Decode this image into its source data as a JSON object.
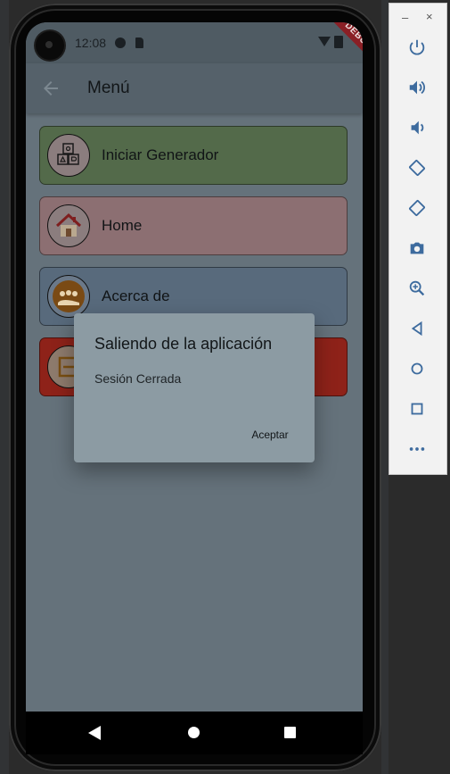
{
  "status_bar": {
    "time": "12:08",
    "debug_banner": "DEBUG"
  },
  "app_bar": {
    "title": "Menú",
    "back_icon": "arrow-back-icon"
  },
  "menu_items": [
    {
      "label": "Iniciar Generador",
      "icon": "toy-blocks-icon",
      "color": "#536a4a"
    },
    {
      "label": "Home",
      "icon": "house-icon",
      "color": "#8c6f72"
    },
    {
      "label": "Acerca de",
      "icon": "team-icon",
      "color": "#586a7c"
    },
    {
      "label": "",
      "icon": "exit-icon",
      "color": "#8e2219"
    }
  ],
  "dialog": {
    "title": "Saliendo de la aplicación",
    "message": "Sesión Cerrada",
    "accept_label": "Aceptar"
  },
  "nav_bar": {
    "back_icon": "nav-back-icon",
    "home_icon": "nav-home-icon",
    "recents_icon": "nav-recents-icon"
  },
  "emulator_panel": {
    "minimize_glyph": "–",
    "close_glyph": "×",
    "controls": [
      {
        "icon": "power-icon",
        "glyph": "⏻"
      },
      {
        "icon": "volume-up-icon",
        "glyph": "🔊"
      },
      {
        "icon": "volume-down-icon",
        "glyph": "🔉"
      },
      {
        "icon": "rotate-left-icon",
        "glyph": "⟲"
      },
      {
        "icon": "rotate-right-icon",
        "glyph": "⟳"
      },
      {
        "icon": "camera-icon",
        "glyph": "📷"
      },
      {
        "icon": "zoom-icon",
        "glyph": "🔍"
      },
      {
        "icon": "back-icon",
        "glyph": "◁"
      },
      {
        "icon": "home-icon",
        "glyph": "○"
      },
      {
        "icon": "overview-icon",
        "glyph": "□"
      },
      {
        "icon": "more-icon",
        "glyph": "•••"
      }
    ]
  }
}
